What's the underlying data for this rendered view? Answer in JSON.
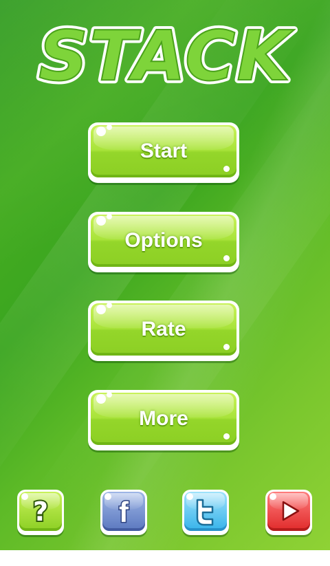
{
  "app": {
    "title": "STACK"
  },
  "menu": {
    "start_label": "Start",
    "options_label": "Options",
    "rate_label": "Rate",
    "more_label": "More"
  },
  "bottom_icons": [
    {
      "name": "help-icon",
      "glyph": "?",
      "color": "#a8e33a"
    },
    {
      "name": "facebook-icon",
      "glyph": "f",
      "color": "#6f8bd0"
    },
    {
      "name": "twitter-icon",
      "glyph": "t",
      "color": "#45bdf0"
    },
    {
      "name": "youtube-icon",
      "glyph": "play",
      "color": "#f04a4a"
    }
  ],
  "colors": {
    "background": "#4aae22",
    "button_green": "#a8e33a",
    "title_green": "#7ed43a"
  }
}
